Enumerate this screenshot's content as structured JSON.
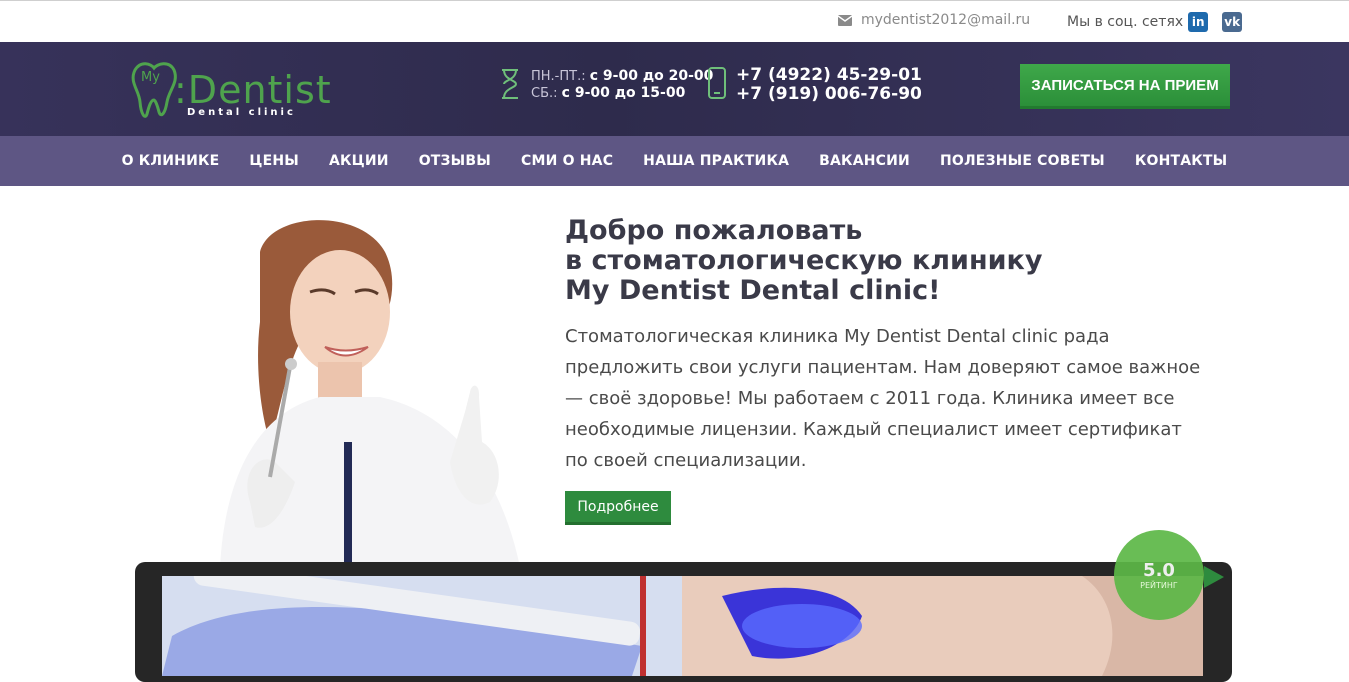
{
  "topbar": {
    "email": "mydentist2012@mail.ru",
    "social_label": "Мы в соц. сетях",
    "linkedin_label": "in",
    "vk_label": "vk"
  },
  "header": {
    "logo": {
      "main": ":Dentist",
      "prefix": "My",
      "subtitle": "Dental clinic"
    },
    "hours": {
      "weekdays_label": "ПН.-ПТ.:",
      "weekdays_value": "с 9-00 до 20-00",
      "saturday_label": "СБ.:",
      "saturday_value": "с 9-00 до 15-00"
    },
    "phones": [
      "+7 (4922) 45-29-01",
      "+7 (919) 006-76-90"
    ],
    "cta_label": "ЗАПИСАТЬСЯ НА ПРИЕМ"
  },
  "nav": {
    "items": [
      {
        "label": "О КЛИНИКЕ"
      },
      {
        "label": "ЦЕНЫ"
      },
      {
        "label": "АКЦИИ"
      },
      {
        "label": "ОТЗЫВЫ"
      },
      {
        "label": "СМИ О НАС"
      },
      {
        "label": "НАША ПРАКТИКА"
      },
      {
        "label": "ВАКАНСИИ"
      },
      {
        "label": "ПОЛЕЗНЫЕ СОВЕТЫ"
      },
      {
        "label": "КОНТАКТЫ"
      }
    ]
  },
  "hero": {
    "title_line1": "Добро пожаловать",
    "title_line2": "в стоматологическую клинику",
    "title_line3": "My Dentist Dental clinic!",
    "text": "Стоматологическая клиника My Dentist Dental clinic рада предложить свои услуги пациентам. Нам доверяют самое важное — своё здоровье! Мы работаем с 2011 года. Клиника имеет все необходимые лицензии. Каждый специалист имеет сертификат по своей специализации.",
    "more_label": "Подробнее"
  },
  "rating": {
    "value": "5.0",
    "label": "РЕЙТИНГ"
  },
  "colors": {
    "header_bg": "#37325a",
    "nav_bg": "#5e5684",
    "accent_green": "#2e8b3e",
    "logo_green": "#4fa34d"
  }
}
